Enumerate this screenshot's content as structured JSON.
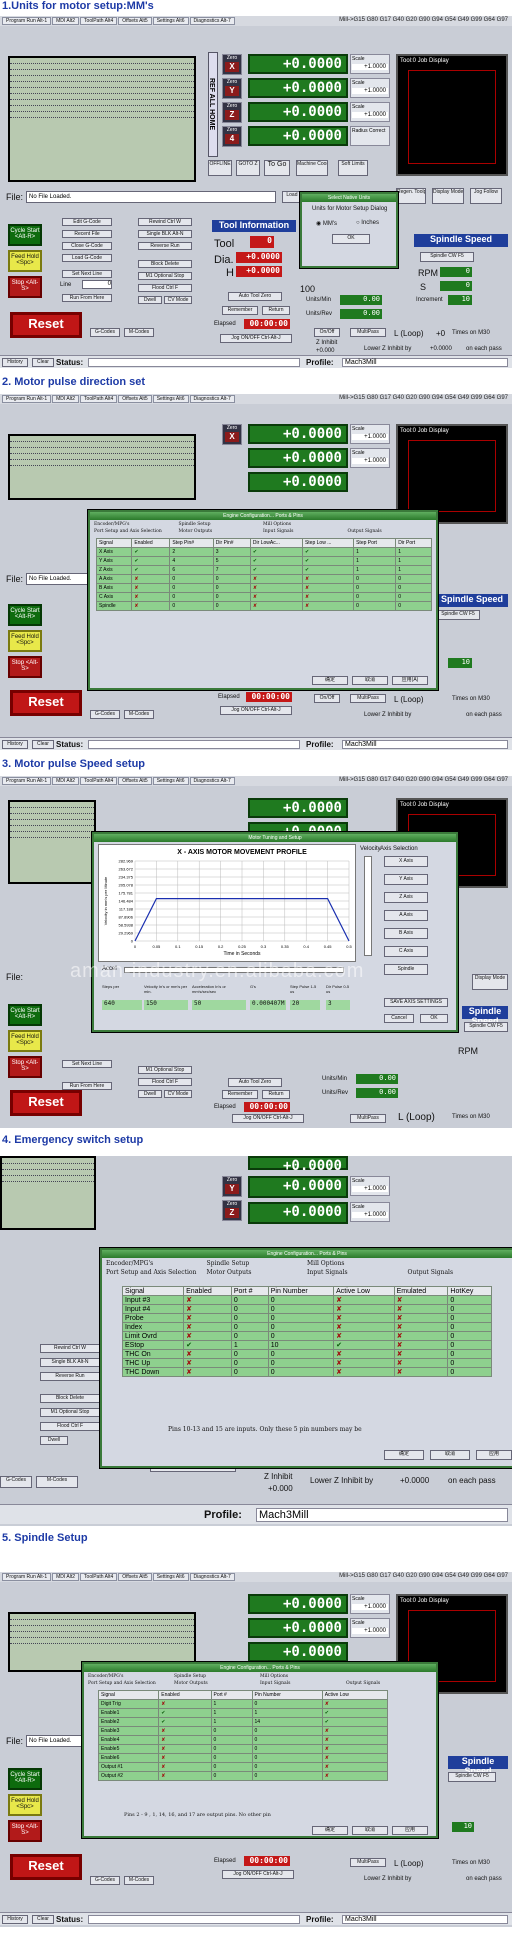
{
  "sections": [
    {
      "title": "1.Units for motor setup:MM's"
    },
    {
      "title": "2. Motor pulse direction set"
    },
    {
      "title": "3. Motor pulse Speed setup"
    },
    {
      "title": "4. Emergency switch setup"
    },
    {
      "title": "5. Spindle Setup"
    }
  ],
  "tabs": [
    "Program Run Alt-1",
    "MDI Alt2",
    "ToolPath Alt4",
    "Offsets Alt5",
    "Settings Alt6",
    "Diagnostics Alt-7"
  ],
  "gcode_modes": "Mill->G15  G80 G17 G40 G20 G90 G94 G54 G49 G99 G64 G97",
  "ref_all": "REF ALL HOME",
  "axes": [
    {
      "letter": "X",
      "dro": "+0.0000",
      "scale": "+1.0000"
    },
    {
      "letter": "Y",
      "dro": "+0.0000",
      "scale": "+1.0000"
    },
    {
      "letter": "Z",
      "dro": "+0.0000",
      "scale": "+1.0000"
    },
    {
      "letter": "4",
      "dro": "+0.0000",
      "scale": "+1.0000"
    }
  ],
  "zero_label": "Zero",
  "scale_label": "Scale",
  "radius_correct": "Radius Correct",
  "tool_display": "Tool:0   Job Display",
  "offline": "OFFLINE",
  "goto_z": "GOTO Z",
  "to_go": "To Go",
  "machine_coords": "Machine Coord's",
  "soft_limits": "Soft Limits",
  "file_label": "File:",
  "file_value": "No File Loaded.",
  "load_wizards": "Load W",
  "last_wizard": "Last Wizard",
  "regen_toolpath": "Regen. Toolpath",
  "display_mode": "Display Mode",
  "jog_follow": "Jog Follow",
  "cycle_start": "Cycle Start <Alt-R>",
  "feed_hold": "Feed Hold <Spc>",
  "stop": "Stop <Alt-S>",
  "reset": "Reset",
  "edit_gcode": "Edit G-Code",
  "recent_file": "Recent File",
  "close_gcode": "Close G-Code",
  "load_gcode": "Load G-Code",
  "set_next_line": "Set Next Line",
  "line_label": "Line",
  "line_value": "0",
  "run_from_here": "Run From Here",
  "rewind": "Rewind Ctrl W",
  "single_blk": "Single BLK Alt-N",
  "reverse_run": "Reverse Run",
  "block_delete": "Block Delete",
  "optional_stop": "M1 Optional Stop",
  "flood": "Flood Ctrl F",
  "dwell": "Dwell",
  "cv_mode": "CV Mode",
  "gcodes": "G-Codes",
  "mcodes": "M-Codes",
  "tool_information": "Tool Information",
  "tool_label": "Tool",
  "tool_value": "0",
  "dia_label": "Dia.",
  "dia_value": "+0.0000",
  "h_label": "H",
  "h_value": "+0.0000",
  "auto_tool_zero": "Auto Tool Zero",
  "remember": "Remember",
  "return_btn": "Return",
  "elapsed_label": "Elapsed",
  "elapsed_value": "00:00:00",
  "jog_onoff": "Jog ON/OFF Ctrl-Alt-J",
  "units_min": "Units/Min",
  "units_rev": "Units/Rev",
  "units_min_value": "0.00",
  "units_rev_value": "0.00",
  "percent": "100",
  "spindle_speed": "Spindle Speed",
  "spindle_cw": "Spindle CW F5",
  "rpm_label": "RPM",
  "rpm_value": "0",
  "s_label": "S",
  "s_value": "0",
  "increment_label": "Increment",
  "increment_value": "10",
  "onoff": "On/Off",
  "multipass": "MultiPass",
  "loop": "L (Loop)",
  "loop_value": "+0",
  "times_on_m30": "Times on M30",
  "z_inhibit": "Z Inhibit",
  "z_inhibit_value": "+0.000",
  "lower_z": "Lower Z Inhibit by",
  "lower_z_value": "+0.0000",
  "on_each_pass": "on each pass",
  "history": "History",
  "clear": "Clear",
  "status_label": "Status:",
  "profile_label": "Profile:",
  "profile_value": "Mach3Mill",
  "units_dialog": {
    "caption": "Select Native Units",
    "title": "Units for Motor Setup Dialog",
    "opt_mm": "MM's",
    "opt_in": "Inches",
    "ok": "OK"
  },
  "engine_caption": "Engine Configuration... Ports & Pins",
  "engine_tabs": [
    "Encoder/MPG's",
    "Spindle Setup",
    "Mill Options",
    "",
    "Port Setup and Axis Selection",
    "Motor Outputs",
    "Input Signals",
    "Output Signals"
  ],
  "motor_outputs": {
    "headers": [
      "Signal",
      "Enabled",
      "Step Pin#",
      "Dir Pin#",
      "Dir LowAc...",
      "Step Low ...",
      "Step Port",
      "Dir Port"
    ],
    "rows": [
      [
        "X Axis",
        "✔",
        "2",
        "3",
        "✔",
        "✔",
        "1",
        "1"
      ],
      [
        "Y Axis",
        "✔",
        "4",
        "5",
        "✔",
        "✔",
        "1",
        "1"
      ],
      [
        "Z Axis",
        "✔",
        "6",
        "7",
        "✔",
        "✔",
        "1",
        "1"
      ],
      [
        "A Axis",
        "✘",
        "0",
        "0",
        "✘",
        "✘",
        "0",
        "0"
      ],
      [
        "B Axis",
        "✘",
        "0",
        "0",
        "✘",
        "✘",
        "0",
        "0"
      ],
      [
        "C Axis",
        "✘",
        "0",
        "0",
        "✘",
        "✘",
        "0",
        "0"
      ],
      [
        "Spindle",
        "✘",
        "0",
        "0",
        "✘",
        "✘",
        "0",
        "0"
      ]
    ],
    "buttons": [
      "确定",
      "取消",
      "应用(A)"
    ]
  },
  "motor_tuning": {
    "caption": "Motor Tuning and Setup",
    "chart_title": "X - AXIS MOTOR MOVEMENT PROFILE",
    "ylabel": "Velocity in mm's per Minute",
    "xlabel": "Time in Seconds",
    "velocity_label": "Velocity",
    "accel_label": "Accel",
    "axis_selection": "Axis Selection",
    "axis_buttons": [
      "X Axis",
      "Y Axis",
      "Z Axis",
      "A Axis",
      "B Axis",
      "C Axis",
      "Spindle"
    ],
    "fields": [
      "Steps per",
      "Velocity In's or mm's per min.",
      "Acceleration In's or mm's/sec/sec",
      "G's",
      "Step Pulse 1-5 us",
      "Dir Pulse 0-5 us"
    ],
    "values": [
      "640",
      "150",
      "50",
      "0.000407M",
      "20",
      "3"
    ],
    "save": "SAVE AXIS SETTINGS",
    "cancel": "Cancel",
    "ok": "OK"
  },
  "chart_data": {
    "type": "line",
    "title": "X - AXIS MOTOR MOVEMENT PROFILE",
    "xlabel": "Time in Seconds",
    "ylabel": "Velocity in mm's per Minute",
    "x_ticks": [
      "0",
      "0.05",
      "0.1",
      "0.15",
      "0.2",
      "0.25",
      "0.3",
      "0.35",
      "0.4",
      "0.45",
      "0.5"
    ],
    "y_ticks": [
      "282.969",
      "263.672",
      "234.375",
      "205.078",
      "175.781",
      "146.484",
      "117.188",
      "87.8906",
      "58.5938",
      "29.2969",
      "0"
    ],
    "ylim": [
      0,
      282.969
    ],
    "xlim": [
      0,
      0.5
    ],
    "series": [
      {
        "x": [
          0,
          0.05,
          0.45,
          0.5
        ],
        "y": [
          0,
          150,
          150,
          0
        ]
      }
    ]
  },
  "watermark": "aman-industry.en.alibaba.com",
  "input_signals": {
    "headers": [
      "Signal",
      "Enabled",
      "Port #",
      "Pin Number",
      "Active Low",
      "Emulated",
      "HotKey"
    ],
    "rows": [
      [
        "Input #3",
        "✘",
        "0",
        "0",
        "✘",
        "✘",
        "0"
      ],
      [
        "Input #4",
        "✘",
        "0",
        "0",
        "✘",
        "✘",
        "0"
      ],
      [
        "Probe",
        "✘",
        "0",
        "0",
        "✘",
        "✘",
        "0"
      ],
      [
        "Index",
        "✘",
        "0",
        "0",
        "✘",
        "✘",
        "0"
      ],
      [
        "Limit Ovrd",
        "✘",
        "0",
        "0",
        "✘",
        "✘",
        "0"
      ],
      [
        "EStop",
        "✔",
        "1",
        "10",
        "✔",
        "✘",
        "0"
      ],
      [
        "THC On",
        "✘",
        "0",
        "0",
        "✘",
        "✘",
        "0"
      ],
      [
        "THC Up",
        "✘",
        "0",
        "0",
        "✘",
        "✘",
        "0"
      ],
      [
        "THC Down",
        "✘",
        "0",
        "0",
        "✘",
        "✘",
        "0"
      ]
    ],
    "note": "Pins 10-13 and 15 are inputs. Only these 5 pin numbers may be",
    "buttons": [
      "确定",
      "取消",
      "应用"
    ]
  },
  "output_signals": {
    "headers": [
      "Signal",
      "Enabled",
      "Port #",
      "Pin Number",
      "Active Low"
    ],
    "rows": [
      [
        "Digit Trig",
        "✘",
        "1",
        "0",
        "✘"
      ],
      [
        "Enable1",
        "✔",
        "1",
        "1",
        "✔"
      ],
      [
        "Enable2",
        "✔",
        "1",
        "14",
        "✔"
      ],
      [
        "Enable3",
        "✘",
        "0",
        "0",
        "✘"
      ],
      [
        "Enable4",
        "✘",
        "0",
        "0",
        "✘"
      ],
      [
        "Enable5",
        "✘",
        "0",
        "0",
        "✘"
      ],
      [
        "Enable6",
        "✘",
        "0",
        "0",
        "✘"
      ],
      [
        "Output #1",
        "✘",
        "0",
        "0",
        "✘"
      ],
      [
        "Output #2",
        "✘",
        "0",
        "0",
        "✘"
      ]
    ],
    "note": "Pins 2 - 9 , 1, 14, 16, and 17 are output pins. No  other pin",
    "buttons": [
      "确定",
      "取消",
      "应用"
    ]
  }
}
